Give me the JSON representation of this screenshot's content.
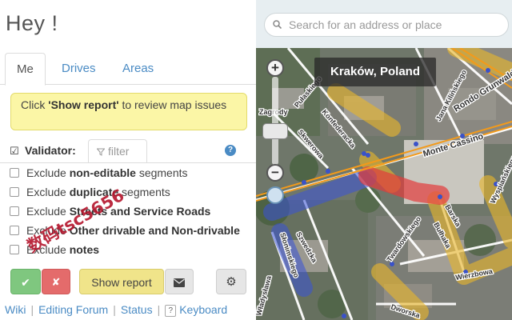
{
  "panel": {
    "greeting": "Hey !",
    "tabs": [
      {
        "label": "Me",
        "active": true
      },
      {
        "label": "Drives",
        "active": false
      },
      {
        "label": "Areas",
        "active": false
      }
    ],
    "hint": {
      "prefix": "Click ",
      "emphasis": "'Show report'",
      "suffix": " to review map issues"
    },
    "validator": {
      "checked": true,
      "label": "Validator:",
      "filter_tab": "filter",
      "help_icon": "question-circle-icon"
    },
    "options": [
      {
        "prefix": "Exclude ",
        "bold": "non-editable",
        "suffix": " segments",
        "checked": false
      },
      {
        "prefix": "Exclude ",
        "bold": "duplicate",
        "suffix": " segments",
        "checked": false
      },
      {
        "prefix": "Exclude ",
        "bold": "Streets and Service Roads",
        "suffix": "",
        "checked": false
      },
      {
        "prefix": "Exclude ",
        "bold": "Other drivable and Non-drivable",
        "suffix": "",
        "checked": false
      },
      {
        "prefix": "Exclude ",
        "bold": "notes",
        "suffix": "",
        "checked": false
      }
    ],
    "buttons": {
      "ok": "✔",
      "cancel": "✘",
      "show_report": "Show report",
      "mail": "envelope-icon",
      "settings": "gear-icon"
    },
    "footer": [
      "Wiki",
      "Editing Forum",
      "Status",
      "Keyboard"
    ],
    "watermark": "数码tsc5656"
  },
  "map": {
    "search_placeholder": "Search for an address or place",
    "location": "Kraków, Poland",
    "streets": [
      "Pułaskiego",
      "Zagrody",
      "Konfederacka",
      "Skwerowa",
      "Monte Cassino",
      "Rondo Grunwaldzkie",
      "Jana Kilińskiego",
      "Słonimskiego",
      "Twardowskiego",
      "Szwedzka",
      "Barska",
      "Wierzbowa",
      "Dworska",
      "Władysława",
      "Wyspiańskiego",
      "Bułhaka"
    ],
    "colors": {
      "highlight_yellow": "#e8b62c",
      "highlight_red": "#e23c3c",
      "highlight_blue": "#3a53d8",
      "segment_node": "#3a52c9"
    }
  }
}
